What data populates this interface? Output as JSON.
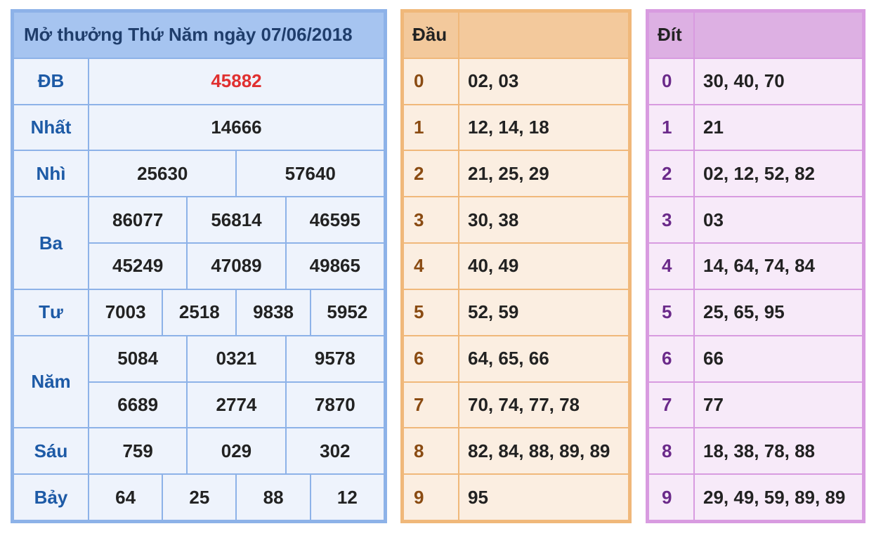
{
  "results": {
    "title": "Mở thưởng Thứ Năm ngày 07/06/2018",
    "db": {
      "label": "ĐB",
      "values": [
        "45882"
      ]
    },
    "nhat": {
      "label": "Nhất",
      "values": [
        "14666"
      ]
    },
    "nhi": {
      "label": "Nhì",
      "values": [
        "25630",
        "57640"
      ]
    },
    "ba": {
      "label": "Ba",
      "values": [
        "86077",
        "56814",
        "46595",
        "45249",
        "47089",
        "49865"
      ]
    },
    "tu": {
      "label": "Tư",
      "values": [
        "7003",
        "2518",
        "9838",
        "5952"
      ]
    },
    "nam": {
      "label": "Năm",
      "values": [
        "5084",
        "0321",
        "9578",
        "6689",
        "2774",
        "7870"
      ]
    },
    "sau": {
      "label": "Sáu",
      "values": [
        "759",
        "029",
        "302"
      ]
    },
    "bay": {
      "label": "Bảy",
      "values": [
        "64",
        "25",
        "88",
        "12"
      ]
    }
  },
  "dau": {
    "header": "Đầu",
    "rows": [
      {
        "idx": "0",
        "vals": "02, 03"
      },
      {
        "idx": "1",
        "vals": "12, 14, 18"
      },
      {
        "idx": "2",
        "vals": "21, 25, 29"
      },
      {
        "idx": "3",
        "vals": "30, 38"
      },
      {
        "idx": "4",
        "vals": "40, 49"
      },
      {
        "idx": "5",
        "vals": "52, 59"
      },
      {
        "idx": "6",
        "vals": "64, 65, 66"
      },
      {
        "idx": "7",
        "vals": "70, 74, 77, 78"
      },
      {
        "idx": "8",
        "vals": "82, 84, 88, 89, 89"
      },
      {
        "idx": "9",
        "vals": "95"
      }
    ]
  },
  "dit": {
    "header": "Đít",
    "rows": [
      {
        "idx": "0",
        "vals": "30, 40, 70"
      },
      {
        "idx": "1",
        "vals": "21"
      },
      {
        "idx": "2",
        "vals": "02, 12, 52, 82"
      },
      {
        "idx": "3",
        "vals": "03"
      },
      {
        "idx": "4",
        "vals": "14, 64, 74, 84"
      },
      {
        "idx": "5",
        "vals": "25, 65, 95"
      },
      {
        "idx": "6",
        "vals": "66"
      },
      {
        "idx": "7",
        "vals": "77"
      },
      {
        "idx": "8",
        "vals": "18, 38, 78, 88"
      },
      {
        "idx": "9",
        "vals": "29, 49, 59, 89, 89"
      }
    ]
  },
  "colors": {
    "results_border": "#8db2e8",
    "results_header": "#a6c4f0",
    "dau_border": "#f0b87a",
    "dit_border": "#d89be0",
    "special_prize": "#e03030",
    "label_blue": "#1d5aa6"
  }
}
